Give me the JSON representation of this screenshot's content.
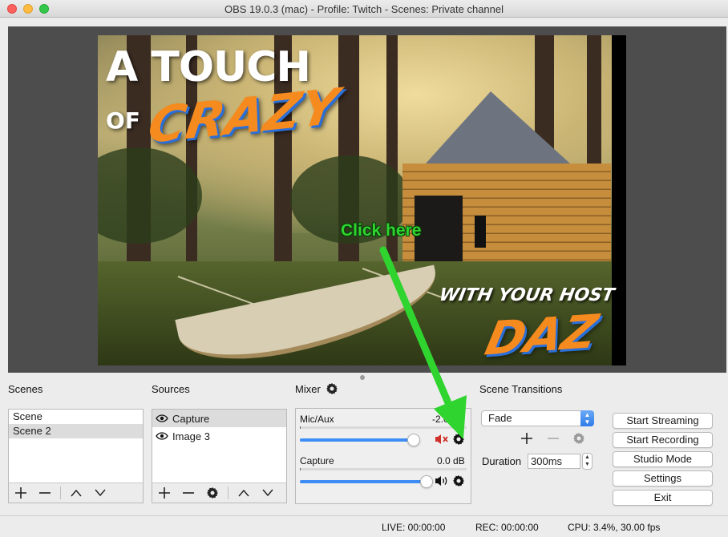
{
  "window": {
    "title": "OBS 19.0.3 (mac) - Profile: Twitch - Scenes: Private channel"
  },
  "preview": {
    "headline": "A TOUCH",
    "headline_of": "OF",
    "headline_crazy": "CRAZY",
    "host_line": "WITH YOUR HOST",
    "host_name": "DAZ"
  },
  "annotation": {
    "text": "Click here",
    "color": "#2fd42f"
  },
  "scenes": {
    "label": "Scenes",
    "items": [
      {
        "label": "Scene",
        "selected": false
      },
      {
        "label": "Scene 2",
        "selected": true
      }
    ]
  },
  "sources": {
    "label": "Sources",
    "items": [
      {
        "label": "Capture",
        "selected": true,
        "icon": "eye-icon"
      },
      {
        "label": "Image 3",
        "selected": false,
        "icon": "eye-icon"
      }
    ]
  },
  "mixer": {
    "label": "Mixer",
    "channels": [
      {
        "name": "Mic/Aux",
        "db": "-2.0 dB",
        "level": 0.92,
        "muted": true
      },
      {
        "name": "Capture",
        "db": "0.0 dB",
        "level": 1.0,
        "muted": false
      }
    ]
  },
  "transitions": {
    "label": "Scene Transitions",
    "selected": "Fade",
    "duration_label": "Duration",
    "duration_value": "300ms"
  },
  "controls": {
    "start_streaming": "Start Streaming",
    "start_recording": "Start Recording",
    "studio_mode": "Studio Mode",
    "settings": "Settings",
    "exit": "Exit"
  },
  "status": {
    "live": "LIVE: 00:00:00",
    "rec": "REC: 00:00:00",
    "cpu": "CPU: 3.4%, 30.00 fps"
  },
  "colors": {
    "accent": "#3d8df5",
    "arrow": "#2fd42f",
    "brand_orange": "#f58a1f"
  }
}
